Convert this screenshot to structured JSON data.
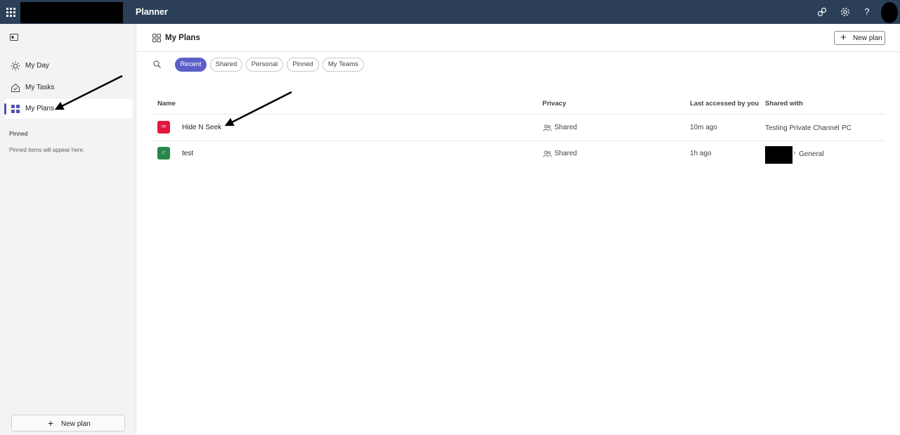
{
  "app": {
    "title": "Planner"
  },
  "topbar": {
    "icons": [
      "waffle-icon",
      "share-link-icon",
      "gear-icon",
      "help-icon",
      "avatar"
    ],
    "help_glyph": "?"
  },
  "sidebar": {
    "items": [
      {
        "label": "My Day",
        "icon": "sun-icon",
        "active": false
      },
      {
        "label": "My Tasks",
        "icon": "home-tasks-icon",
        "active": false
      },
      {
        "label": "My Plans",
        "icon": "grid-icon",
        "active": true
      }
    ],
    "pinned_heading": "Pinned",
    "pinned_empty": "Pinned items will appear here.",
    "new_plan_label": "New plan"
  },
  "main": {
    "title": "My Plans",
    "new_plan_label": "New plan",
    "filters": [
      {
        "label": "Recent",
        "selected": true
      },
      {
        "label": "Shared",
        "selected": false
      },
      {
        "label": "Personal",
        "selected": false
      },
      {
        "label": "Pinned",
        "selected": false
      },
      {
        "label": "My Teams",
        "selected": false
      }
    ],
    "table": {
      "columns": [
        "Name",
        "Privacy",
        "Last accessed by you",
        "Shared with"
      ],
      "rows": [
        {
          "badge": "TP",
          "badge_color": "#e3173e",
          "name": "Hide N Seek",
          "privacy": "Shared",
          "last_accessed": "10m ago",
          "team": "Testing Private Channel",
          "channel": "PC"
        },
        {
          "badge": "C",
          "badge_color": "#27864a",
          "name": "test",
          "privacy": "Shared",
          "last_accessed": "1h ago",
          "team": "",
          "channel": "General"
        }
      ]
    }
  },
  "colors": {
    "topbar": "#2b4058",
    "accent": "#5b5fc7",
    "sidebar_bg": "#f3f3f3"
  }
}
